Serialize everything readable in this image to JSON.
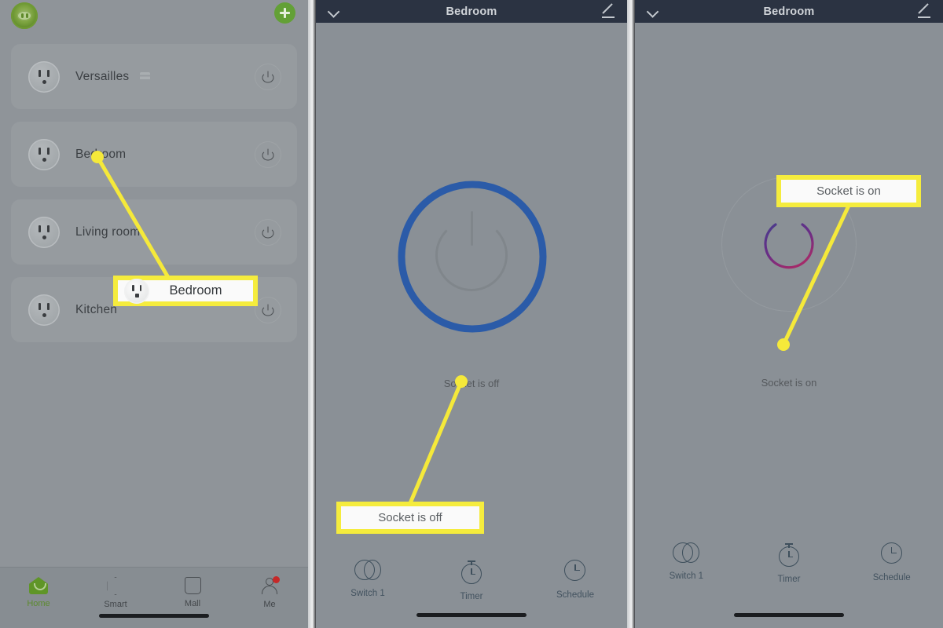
{
  "panel_home": {
    "logo_icon": "app-logo-icon",
    "add_button_label": "+",
    "devices": [
      {
        "name": "Versailles",
        "icon": "socket-icon",
        "has_badge": true,
        "power_icon": "power-icon"
      },
      {
        "name": "Bedroom",
        "icon": "socket-icon",
        "has_badge": false,
        "power_icon": "power-icon"
      },
      {
        "name": "Living room",
        "icon": "socket-icon",
        "has_badge": false,
        "power_icon": "power-icon"
      },
      {
        "name": "Kitchen",
        "icon": "socket-icon",
        "has_badge": false,
        "power_icon": "power-icon"
      }
    ],
    "tabs": [
      {
        "label": "Home",
        "icon": "home-icon",
        "active": true,
        "badge": false
      },
      {
        "label": "Smart",
        "icon": "hexagon-icon",
        "active": false,
        "badge": false
      },
      {
        "label": "Mall",
        "icon": "bag-icon",
        "active": false,
        "badge": false
      },
      {
        "label": "Me",
        "icon": "person-icon",
        "active": false,
        "badge": true
      }
    ]
  },
  "panel_detail_off": {
    "header": {
      "title": "Bedroom",
      "back_icon": "chevron-left-icon",
      "edit_icon": "pencil-icon"
    },
    "power_state": "off",
    "state_label": "Socket is off",
    "tabs": [
      {
        "label": "Switch 1",
        "icon": "switch-icon"
      },
      {
        "label": "Timer",
        "icon": "stopwatch-icon"
      },
      {
        "label": "Schedule",
        "icon": "clock-icon"
      }
    ]
  },
  "panel_detail_on": {
    "header": {
      "title": "Bedroom",
      "back_icon": "chevron-left-icon",
      "edit_icon": "pencil-icon"
    },
    "power_state": "on",
    "state_label": "Socket is on",
    "tabs": [
      {
        "label": "Switch 1",
        "icon": "switch-icon"
      },
      {
        "label": "Timer",
        "icon": "stopwatch-icon"
      },
      {
        "label": "Schedule",
        "icon": "clock-icon"
      }
    ]
  },
  "annotations": {
    "callout_bedroom": "Bedroom",
    "callout_socket_off": "Socket is off",
    "callout_socket_on": "Socket is on",
    "highlight_color": "#f5ec3d",
    "circle_color": "#2b5ba8",
    "power_on_color": "#8e2a6b"
  }
}
